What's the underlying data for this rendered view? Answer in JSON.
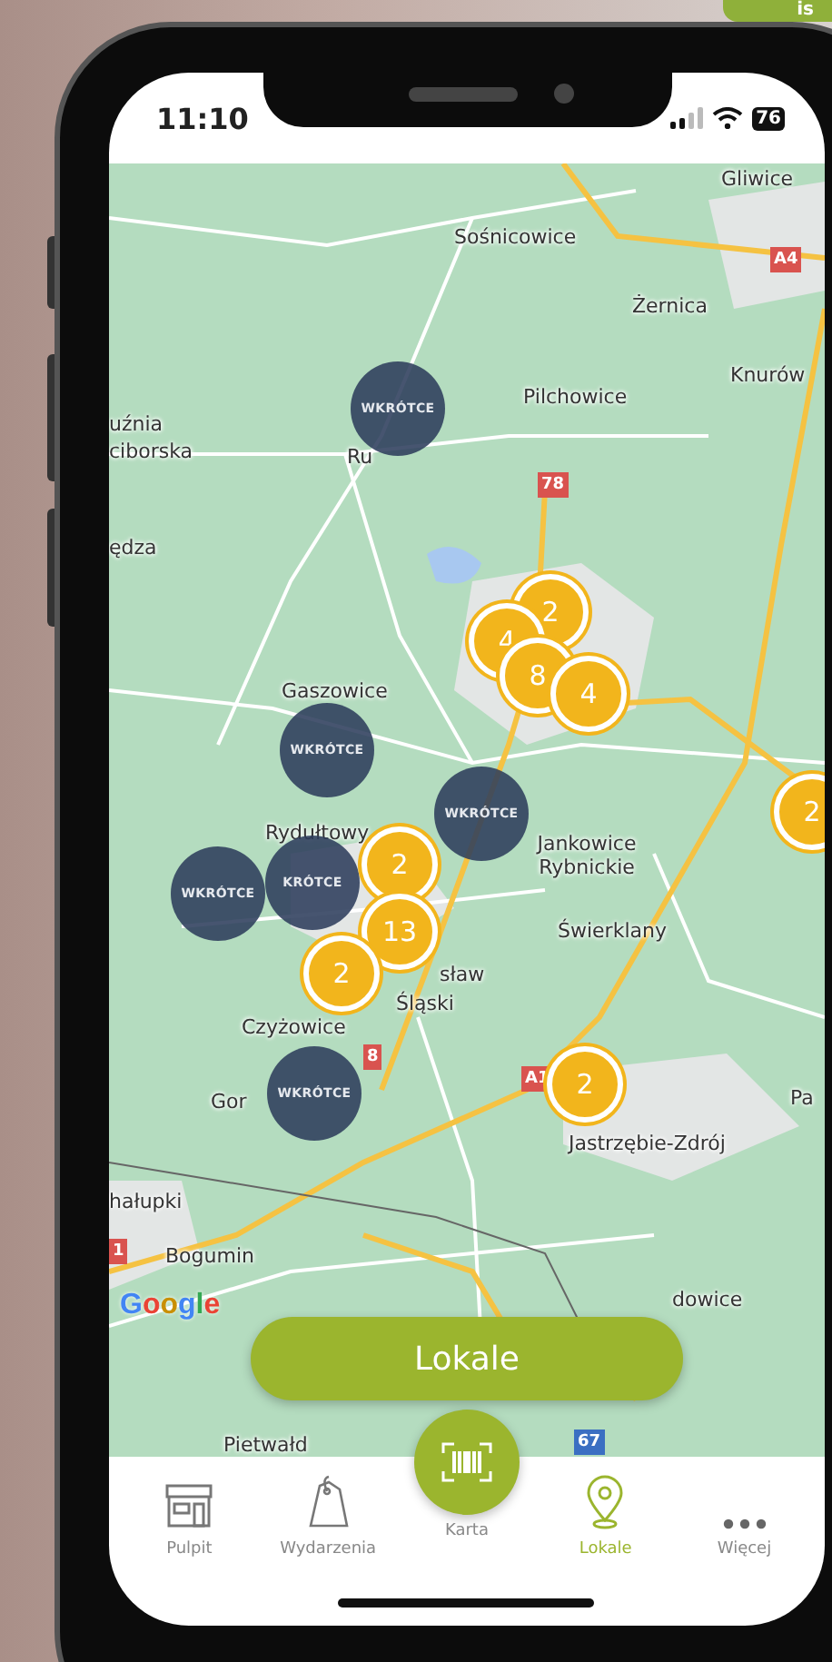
{
  "corner_banner": {
    "text": "is"
  },
  "status_bar": {
    "time": "11:10",
    "battery": "76"
  },
  "map": {
    "places": [
      "Gliwice",
      "Sośnicowice",
      "Żernica",
      "Knurów",
      "Pilchowice",
      "uźnia",
      "ciborska",
      "Ru",
      "ędza",
      "Gaszowice",
      "Rydułtowy",
      "Jankowice Rybnickie",
      "Świerklany",
      "sław",
      "Śląski",
      "Czyżowice",
      "Gor",
      "Jastrzębie-Zdrój",
      "Pa",
      "hałupki",
      "Bogumin",
      "dowice",
      "Pietwałd"
    ],
    "road_signs": [
      {
        "label": "A4",
        "color": "#d9534f"
      },
      {
        "label": "78",
        "color": "#d9534f"
      },
      {
        "label": "8",
        "color": "#d9534f"
      },
      {
        "label": "A1",
        "color": "#d9534f"
      },
      {
        "label": "1",
        "color": "#d9534f"
      },
      {
        "label": "67",
        "color": "#3b6fc2"
      }
    ],
    "clusters": [
      {
        "kind": "soon",
        "label": "WKRÓTCE"
      },
      {
        "kind": "count",
        "label": "2"
      },
      {
        "kind": "count",
        "label": "4"
      },
      {
        "kind": "count",
        "label": "8"
      },
      {
        "kind": "count",
        "label": "4"
      },
      {
        "kind": "soon",
        "label": "WKRÓTCE"
      },
      {
        "kind": "count",
        "label": "2"
      },
      {
        "kind": "soon",
        "label": "WKRÓTCE"
      },
      {
        "kind": "soon",
        "label": "WKRÓTCE"
      },
      {
        "kind": "soon",
        "label": "KRÓTCE"
      },
      {
        "kind": "count",
        "label": "2"
      },
      {
        "kind": "count",
        "label": "13"
      },
      {
        "kind": "count",
        "label": "2"
      },
      {
        "kind": "soon",
        "label": "WKRÓTCE"
      },
      {
        "kind": "count",
        "label": "2"
      }
    ],
    "attribution": "Google"
  },
  "locations_button": "Lokale",
  "tabs": [
    {
      "kind": "store",
      "label": "Pulpit",
      "selected": false
    },
    {
      "kind": "tag",
      "label": "Wydarzenia",
      "selected": false
    },
    {
      "kind": "card",
      "label": "Karta",
      "selected": false
    },
    {
      "kind": "pin",
      "label": "Lokale",
      "selected": true
    },
    {
      "kind": "more",
      "label": "Więcej",
      "selected": false
    }
  ]
}
